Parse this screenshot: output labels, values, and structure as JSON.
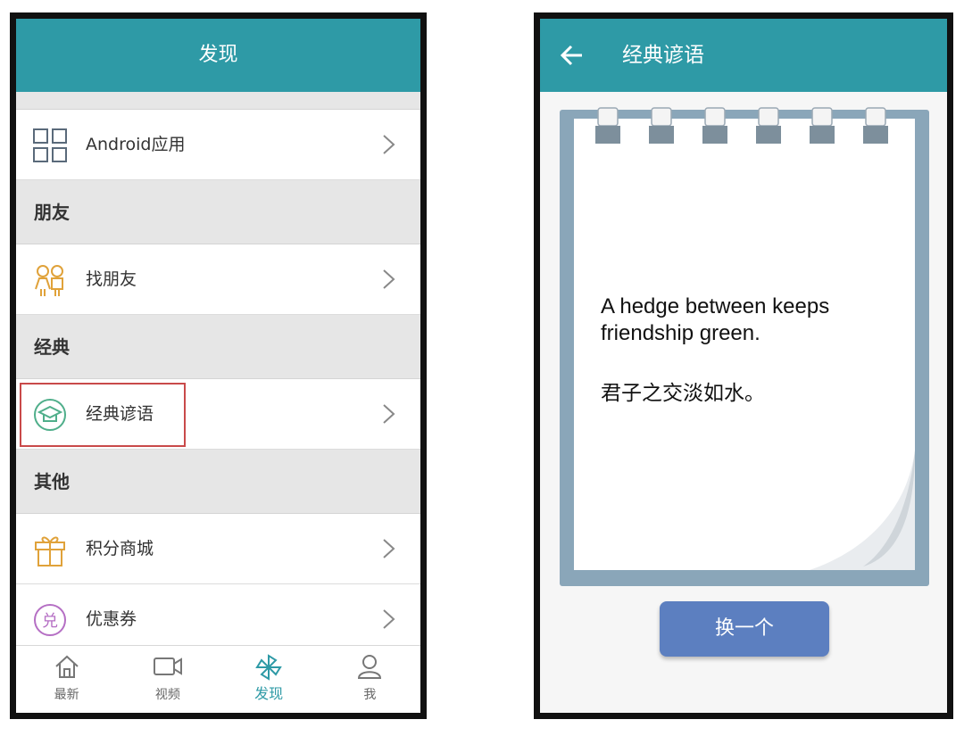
{
  "left": {
    "title": "发现",
    "items": {
      "android": "Android应用",
      "friends_section": "朋友",
      "find_friends": "找朋友",
      "classic_section": "经典",
      "classic_quotes": "经典谚语",
      "other_section": "其他",
      "points_mall": "积分商城",
      "coupons": "优惠券"
    },
    "coupon_icon_char": "兑",
    "tabs": [
      "最新",
      "视频",
      "发现",
      "我"
    ],
    "active_tab": "发现"
  },
  "right": {
    "title": "经典谚语",
    "quote_en_line1": "A hedge between keeps",
    "quote_en_line2": "friendship green.",
    "quote_zh": "君子之交淡如水。",
    "button_label": "换一个"
  },
  "colors": {
    "teal": "#2e9aa6",
    "button": "#5c7fc0",
    "highlight": "#c94a4a",
    "notepad": "#8aa6b9"
  }
}
